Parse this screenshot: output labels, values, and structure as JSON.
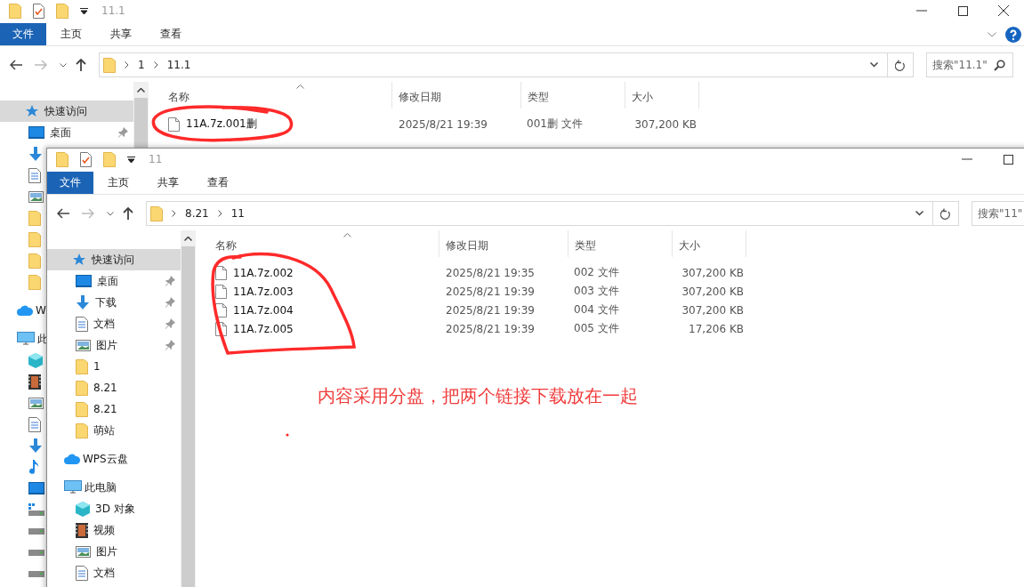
{
  "windows": [
    {
      "title": "11.1",
      "help": true,
      "ribbon_tabs": [
        {
          "label": "文件",
          "selected": true
        },
        {
          "label": "主页",
          "selected": false
        },
        {
          "label": "共享",
          "selected": false
        },
        {
          "label": "查看",
          "selected": false
        }
      ],
      "path": [
        "1",
        "11.1"
      ],
      "search": {
        "placeholder": "搜索\"11.1\""
      },
      "sidebar": [
        {
          "kind": "quick",
          "label": "快速访问",
          "selected": true,
          "children": [
            {
              "kind": "desktop",
              "label": "桌面",
              "pinned": true,
              "selected": false
            },
            {
              "kind": "downloads",
              "pinned": false,
              "selected": false
            },
            {
              "kind": "documents",
              "pinned": false,
              "selected": false
            },
            {
              "kind": "pictures",
              "pinned": false,
              "selected": false
            },
            {
              "kind": "folder",
              "pinned": false,
              "selected": false
            },
            {
              "kind": "folder",
              "pinned": false,
              "selected": false
            },
            {
              "kind": "folder",
              "pinned": false,
              "selected": false
            },
            {
              "kind": "folder",
              "pinned": false,
              "selected": false
            }
          ]
        },
        {
          "kind": "cloud",
          "label": "W",
          "selected": false
        },
        {
          "kind": "pc",
          "label": "此",
          "selected": false,
          "children": [
            {
              "kind": "objects",
              "pinned": false,
              "selected": false
            },
            {
              "kind": "video",
              "pinned": false,
              "selected": false
            },
            {
              "kind": "pictures",
              "pinned": false,
              "selected": false
            },
            {
              "kind": "documents",
              "pinned": false,
              "selected": false
            },
            {
              "kind": "downloads",
              "pinned": false,
              "selected": false
            },
            {
              "kind": "music",
              "pinned": false,
              "selected": false
            },
            {
              "kind": "desktop",
              "pinned": false,
              "selected": false
            },
            {
              "kind": "windrive",
              "pinned": false,
              "selected": false
            },
            {
              "kind": "drive",
              "pinned": false,
              "selected": false
            },
            {
              "kind": "drive",
              "pinned": false,
              "selected": false
            },
            {
              "kind": "drive",
              "pinned": false,
              "selected": false
            }
          ]
        }
      ],
      "columns": [
        "名称",
        "修改日期",
        "类型",
        "大小"
      ],
      "files": [
        {
          "name": "11A.7z.001删",
          "modified": "2025/8/21 19:39",
          "type": "001删 文件",
          "size": "307,200 KB"
        }
      ]
    },
    {
      "title": "11",
      "ribbon_tabs": [
        {
          "label": "文件",
          "selected": true
        },
        {
          "label": "主页",
          "selected": false
        },
        {
          "label": "共享",
          "selected": false
        },
        {
          "label": "查看",
          "selected": false
        }
      ],
      "path": [
        "8.21",
        "11"
      ],
      "search": {
        "placeholder": "搜索\"11\""
      },
      "sidebar": [
        {
          "kind": "quick",
          "label": "快速访问",
          "selected": true,
          "children": [
            {
              "kind": "desktop",
              "label": "桌面",
              "pinned": true,
              "selected": false
            },
            {
              "kind": "downloads",
              "label": "下载",
              "pinned": true,
              "selected": false
            },
            {
              "kind": "documents",
              "label": "文档",
              "pinned": true,
              "selected": false
            },
            {
              "kind": "pictures",
              "label": "图片",
              "pinned": true,
              "selected": false
            },
            {
              "kind": "folder",
              "label": "1",
              "pinned": false,
              "selected": false
            },
            {
              "kind": "folder",
              "label": "8.21",
              "pinned": false,
              "selected": false
            },
            {
              "kind": "folder",
              "label": "8.21",
              "pinned": false,
              "selected": false
            },
            {
              "kind": "folder",
              "label": "萌站",
              "pinned": false,
              "selected": false
            }
          ]
        },
        {
          "kind": "cloud",
          "label": "WPS云盘",
          "selected": false
        },
        {
          "kind": "pc",
          "label": "此电脑",
          "selected": false,
          "children": [
            {
              "kind": "objects",
              "label": "3D 对象",
              "pinned": false,
              "selected": false
            },
            {
              "kind": "video",
              "label": "视频",
              "pinned": false,
              "selected": false
            },
            {
              "kind": "pictures",
              "label": "图片",
              "pinned": false,
              "selected": false
            },
            {
              "kind": "documents",
              "label": "文档",
              "pinned": false,
              "selected": false
            }
          ]
        }
      ],
      "columns": [
        "名称",
        "修改日期",
        "类型",
        "大小"
      ],
      "files": [
        {
          "name": "11A.7z.002",
          "modified": "2025/8/21 19:35",
          "type": "002 文件",
          "size": "307,200 KB"
        },
        {
          "name": "11A.7z.003",
          "modified": "2025/8/21 19:39",
          "type": "003 文件",
          "size": "307,200 KB"
        },
        {
          "name": "11A.7z.004",
          "modified": "2025/8/21 19:39",
          "type": "004 文件",
          "size": "307,200 KB"
        },
        {
          "name": "11A.7z.005",
          "modified": "2025/8/21 19:39",
          "type": "005 文件",
          "size": "17,206 KB"
        }
      ]
    }
  ],
  "annotation": {
    "text": "内容采用分盘，把两个链接下载放在一起"
  }
}
